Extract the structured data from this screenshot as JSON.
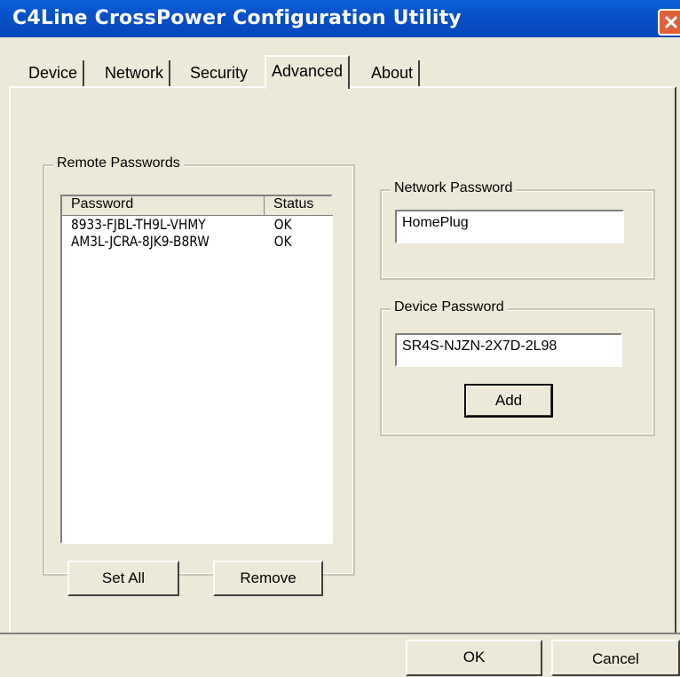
{
  "window": {
    "title": "C4Line CrossPower Configuration Utility"
  },
  "tabs": [
    {
      "label": "Device"
    },
    {
      "label": "Network"
    },
    {
      "label": "Security"
    },
    {
      "label": "Advanced"
    },
    {
      "label": "About"
    }
  ],
  "remote_passwords": {
    "legend": "Remote Passwords",
    "columns": [
      "Password",
      "Status"
    ],
    "rows": [
      {
        "password": "8933-FJBL-TH9L-VHMY",
        "status": "OK"
      },
      {
        "password": "AM3L-JCRA-8JK9-B8RW",
        "status": "OK"
      }
    ],
    "set_all_label": "Set All",
    "remove_label": "Remove"
  },
  "network_password": {
    "legend": "Network Password",
    "value": "HomePlug"
  },
  "device_password": {
    "legend": "Device Password",
    "value": "SR4S-NJZN-2X7D-2L98",
    "add_label": "Add"
  },
  "footer": {
    "ok_label": "OK",
    "cancel_label": "Cancel"
  }
}
